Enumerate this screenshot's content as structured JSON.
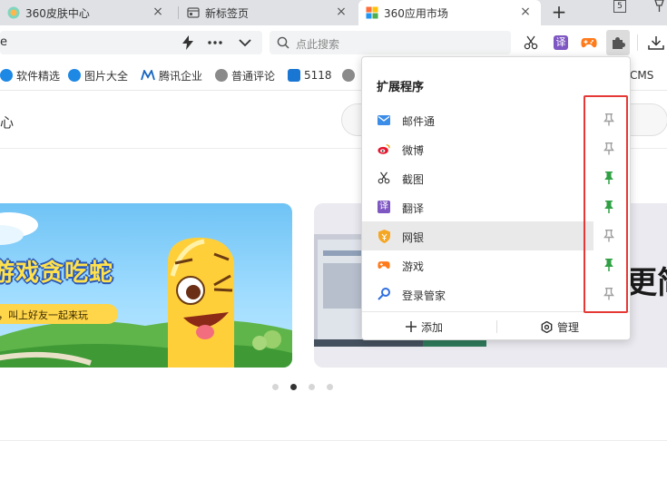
{
  "tabs": [
    {
      "label": "360皮肤中心",
      "icon": "skin-center-icon"
    },
    {
      "label": "新标签页",
      "icon": "new-tab-page-icon"
    },
    {
      "label": "360应用市场",
      "icon": "app-market-icon"
    }
  ],
  "tab_controls": {
    "new_tab": "+",
    "tab_count": "5"
  },
  "omnibox": {
    "url_fragment": "e"
  },
  "search": {
    "placeholder": "点此搜索"
  },
  "toolbar_icons": [
    "lightning-icon",
    "more-icon",
    "chevron-down-icon",
    "screenshot-scissors-icon",
    "translate-icon",
    "game-icon",
    "extensions-puzzle-icon",
    "download-icon"
  ],
  "translate_badge": "译",
  "bookmarks": [
    {
      "label": "软件精选",
      "color": "#1e88e5"
    },
    {
      "label": "图片大全",
      "color": "#1e88e5"
    },
    {
      "label": "腾讯企业",
      "color": "#1565c0"
    },
    {
      "label": "普通评论",
      "color": "#777777"
    },
    {
      "label": "5118",
      "color": "#1976d2"
    },
    {
      "label": "CMS",
      "color": "#d84315"
    }
  ],
  "page": {
    "header_fragment": "心",
    "banner_left": {
      "title": "游戏贪吃蛇",
      "subtitle": "，叫上好友一起来玩"
    },
    "banner_right": {
      "text": "更简"
    },
    "carousel": {
      "count": 4,
      "active": 1
    }
  },
  "extension_popup": {
    "title": "扩展程序",
    "items": [
      {
        "name": "邮件通",
        "icon": "mail-icon",
        "pinned": false
      },
      {
        "name": "微博",
        "icon": "weibo-icon",
        "pinned": false
      },
      {
        "name": "截图",
        "icon": "scissors-icon",
        "pinned": true
      },
      {
        "name": "翻译",
        "icon": "translate-icon",
        "pinned": true
      },
      {
        "name": "网银",
        "icon": "bank-shield-icon",
        "pinned": false
      },
      {
        "name": "游戏",
        "icon": "gamepad-icon",
        "pinned": true
      },
      {
        "name": "登录管家",
        "icon": "login-key-icon",
        "pinned": false
      }
    ],
    "hovered_index": 4,
    "add_label": "添加",
    "manage_label": "管理"
  },
  "colors": {
    "pinned": "#2ea043",
    "unpinned": "#9e9e9e",
    "highlight": "#e53935",
    "accent_purple": "#7e57c2",
    "accent_orange": "#ff7a1a"
  }
}
